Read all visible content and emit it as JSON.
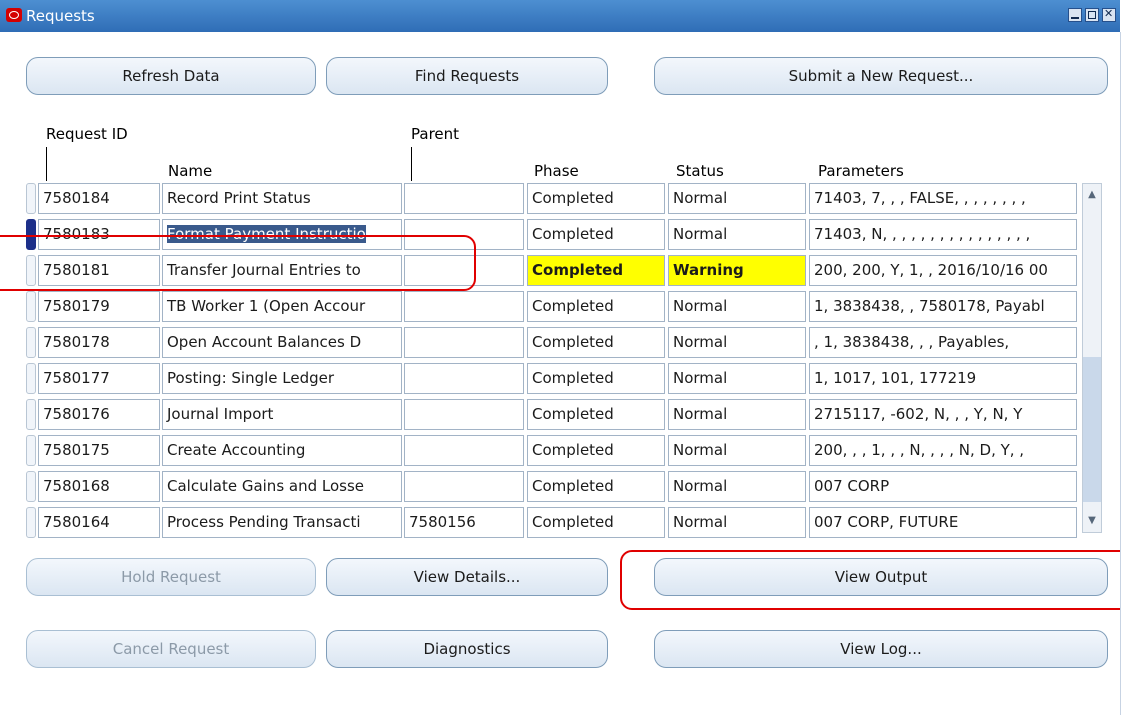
{
  "window": {
    "title": "Requests"
  },
  "top_buttons": {
    "refresh": "Refresh Data",
    "find": "Find Requests",
    "submit": "Submit a New Request..."
  },
  "columns": {
    "request_id": "Request ID",
    "name": "Name",
    "parent": "Parent",
    "phase": "Phase",
    "status": "Status",
    "parameters": "Parameters"
  },
  "rows": [
    {
      "id": "7580184",
      "name": "Record Print Status",
      "parent": "",
      "phase": "Completed",
      "status": "Normal",
      "params": "71403, 7, , , FALSE, , , , , , , ,"
    },
    {
      "id": "7580183",
      "name": "Format Payment Instructio",
      "parent": "",
      "phase": "Completed",
      "status": "Normal",
      "params": "71403, N, , , , , , , , , , , , , , , ,"
    },
    {
      "id": "7580181",
      "name": "Transfer Journal Entries to",
      "parent": "",
      "phase": "Completed",
      "status": "Warning",
      "params": "200, 200, Y, 1, , 2016/10/16 00"
    },
    {
      "id": "7580179",
      "name": "TB Worker 1 (Open Accour",
      "parent": "",
      "phase": "Completed",
      "status": "Normal",
      "params": "1, 3838438, , 7580178, Payabl"
    },
    {
      "id": "7580178",
      "name": "Open Account Balances D",
      "parent": "",
      "phase": "Completed",
      "status": "Normal",
      "params": ", 1, 3838438, , , Payables,"
    },
    {
      "id": "7580177",
      "name": "Posting: Single Ledger",
      "parent": "",
      "phase": "Completed",
      "status": "Normal",
      "params": "1, 1017, 101, 177219"
    },
    {
      "id": "7580176",
      "name": "Journal Import",
      "parent": "",
      "phase": "Completed",
      "status": "Normal",
      "params": "2715117, -602, N, , , Y, N, Y"
    },
    {
      "id": "7580175",
      "name": "Create Accounting",
      "parent": "",
      "phase": "Completed",
      "status": "Normal",
      "params": "200, , , 1, , , N, , , , N, D, Y, ,"
    },
    {
      "id": "7580168",
      "name": "Calculate Gains and Losse",
      "parent": "",
      "phase": "Completed",
      "status": "Normal",
      "params": "007 CORP"
    },
    {
      "id": "7580164",
      "name": "Process Pending Transacti",
      "parent": "7580156",
      "phase": "Completed",
      "status": "Normal",
      "params": "007 CORP, FUTURE"
    }
  ],
  "bottom_buttons": {
    "hold": "Hold Request",
    "details": "View Details...",
    "output": "View Output",
    "cancel": "Cancel Request",
    "diagnostics": "Diagnostics",
    "log": "View Log..."
  },
  "colors": {
    "highlight": "#ffff00",
    "annotation": "#e00000",
    "titlebar": "#3b7cc4"
  },
  "icons": [
    "oracle-logo-icon",
    "minimize-icon",
    "maximize-icon",
    "close-icon",
    "scroll-up-icon",
    "scroll-down-icon"
  ]
}
